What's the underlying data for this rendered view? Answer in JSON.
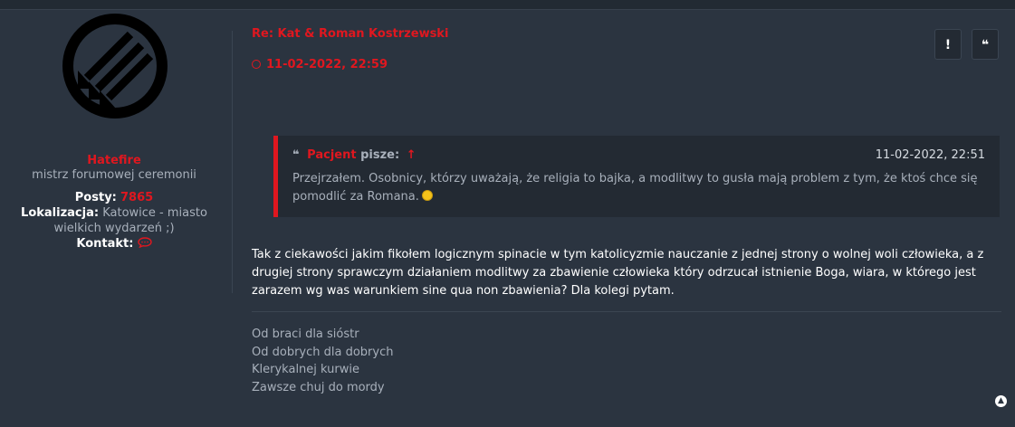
{
  "profile": {
    "username": "Hatefire",
    "rank": "mistrz forumowej ceremonii",
    "posts_label": "Posty:",
    "posts_value": "7865",
    "location_label": "Lokalizacja:",
    "location_value_line1": "Katowice - miasto",
    "location_value_line2": "wielkich wydarzeń ;)",
    "contact_label": "Kontakt:"
  },
  "post": {
    "title": "Re: Kat & Roman Kostrzewski",
    "date": "11-02-2022, 22:59",
    "report_button": "!",
    "quote_button": "❝"
  },
  "quote": {
    "author": "Pacjent",
    "writes": "pisze:",
    "arrow": "↑",
    "date": "11-02-2022, 22:51",
    "text": "Przejrzałem. Osobnicy, którzy uważają, że religia to bajka, a modlitwy to gusła mają problem z tym, że ktoś chce się pomodlić za Romana."
  },
  "content": {
    "text": "Tak z ciekawości jakim fikołem logicznym spinacie w tym katolicyzmie nauczanie z jednej strony o wolnej woli człowieka, a z drugiej strony sprawczym działaniem modlitwy za zbawienie człowieka który odrzucał istnienie Boga, wiara, w którego jest zarazem wg was warunkiem sine qua non zbawienia? Dla kolegi pytam."
  },
  "signature": {
    "line1": "Od braci dla sióstr",
    "line2": "Od dobrych dla dobrych",
    "line3": "Klerykalnej kurwie",
    "line4": "Zawsze chuj do mordy"
  },
  "colors": {
    "accent": "#e0171f",
    "background": "#2b3440",
    "quote_bg": "#232a33"
  },
  "icons": {
    "avatar": "iron-front-arrows-logo",
    "clock": "clock-icon",
    "contact": "message-bubble-icon",
    "scroll_top": "chevron-up-icon"
  }
}
